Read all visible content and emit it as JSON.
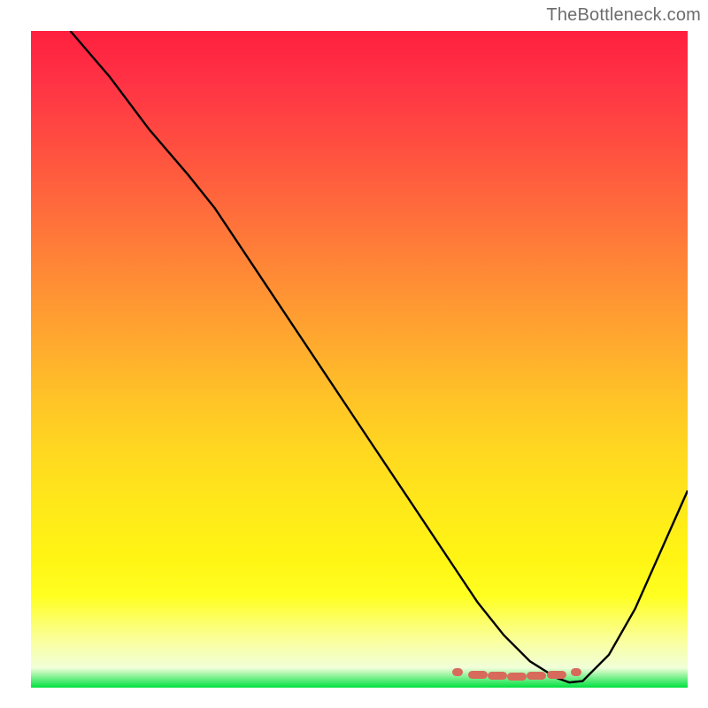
{
  "watermark": "TheBottleneck.com",
  "colors": {
    "gradient_top": "#ff203f",
    "gradient_bottom": "#00e040",
    "curve": "#000000",
    "dots": "#d86a5c"
  },
  "chart_data": {
    "type": "line",
    "title": "",
    "xlabel": "",
    "ylabel": "",
    "xlim": [
      0,
      100
    ],
    "ylim": [
      0,
      100
    ],
    "series": [
      {
        "name": "bottleneck-curve",
        "x": [
          6,
          12,
          18,
          24,
          28,
          34,
          40,
          46,
          52,
          58,
          64,
          68,
          72,
          76,
          80,
          82,
          84,
          88,
          92,
          96,
          100
        ],
        "values": [
          100,
          93,
          85,
          78,
          73,
          64,
          55,
          46,
          37,
          28,
          19,
          13,
          8,
          4,
          1.5,
          0.8,
          1.0,
          5,
          12,
          21,
          30
        ]
      }
    ],
    "markers": {
      "name": "highlight-dots",
      "x": [
        65,
        68,
        71,
        74,
        77,
        80,
        83
      ],
      "values": [
        2.3,
        2.0,
        1.8,
        1.7,
        1.8,
        2.0,
        2.3
      ]
    },
    "annotations": []
  }
}
